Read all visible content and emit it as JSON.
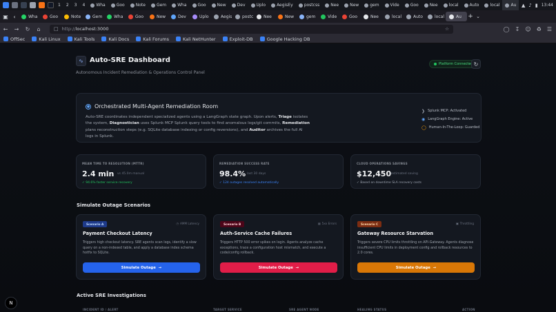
{
  "taskbar": {
    "workspaces": [
      "1",
      "2",
      "3",
      "4"
    ],
    "windows": [
      "Wha",
      "Goo",
      "Note",
      "Gem",
      "Wha",
      "Goo",
      "New",
      "Dev",
      "Uplo",
      "AegisEy",
      "postcss",
      "Nee",
      "New",
      "gem",
      "Vide",
      "Goo",
      "Nee",
      "local",
      "Auto",
      "local",
      "Au"
    ],
    "clock": "13:44"
  },
  "browser": {
    "tabs": [
      "Auto",
      "Auto",
      "Auto",
      "Auto",
      "Auto",
      "Auto",
      "Auto",
      "Auto",
      "Auto",
      "Auto",
      "Auto",
      "Auto",
      "Auto",
      "Auto",
      "Auto",
      "Auto",
      "Auto",
      "Auto",
      "Auto",
      "Auto",
      "Au"
    ],
    "url_prefix": "http://",
    "url_host": "localhost:3000",
    "bookmarks": [
      "OffSec",
      "Kali Linux",
      "Kali Tools",
      "Kali Docs",
      "Kali Forums",
      "Kali NetHunter",
      "Exploit-DB",
      "Google Hacking DB"
    ]
  },
  "header": {
    "title": "Auto-SRE Dashboard",
    "subtitle": "Autonomous Incident Remediation & Operations Control Panel",
    "status": "Platform Connected"
  },
  "orchestration": {
    "title": "Orchestrated Multi-Agent Remediation Room",
    "desc_1": "Auto-SRE coordinates independent specialized agents using a LangGraph state graph. Upon alerts, ",
    "triage": "Triage",
    "desc_2": " isolates the system, ",
    "diagnostician": "Diagnostician",
    "desc_3": " uses Splunk MCP Splunk query tools to find anomalous logs/git commits, ",
    "remediation": "Remediation",
    "desc_4": " plans reconstruction steps (e.g. SQLite database indexing or config reversions), and ",
    "auditor": "Auditor",
    "desc_5": " archives the full AI logs in Splunk.",
    "items": [
      "Splunk MCP: Activated",
      "LangGraph Engine: Active",
      "Human-In-The-Loop: Guarded"
    ]
  },
  "metrics": [
    {
      "label": "MEAN TIME TO RESOLUTION (MTTR)",
      "value": "2.4 min",
      "sub": "vs 45.0m manual",
      "foot": "✓ 94.6% faster service recovery",
      "foot_color": "#22c55e"
    },
    {
      "label": "REMEDIATION SUCCESS RATE",
      "value": "98.4%",
      "sub": "last 30 days",
      "foot": "✓ 124 outages resolved automatically",
      "foot_color": "#3b82f6"
    },
    {
      "label": "CLOUD OPERATIONS SAVINGS",
      "value": "$12,450",
      "sub": "estimated saving",
      "foot": "✓ Based on downtime SLA recovery costs",
      "foot_color": "#9ca3af"
    }
  ],
  "scenarios_title": "Simulate Outage Scenarios",
  "scenarios": [
    {
      "badge": "Scenario A",
      "tag": "AMM Latency",
      "title": "Payment Checkout Latency",
      "desc": "Triggers high checkout latency. SRE agents scan logs, identify a slow query on a non-indexed table, and apply a database index schema hotfix to SQLite.",
      "button": "Simulate Outage",
      "color": "#2563eb",
      "badge_bg": "#1e3a8a",
      "badge_fg": "#bfdbfe"
    },
    {
      "badge": "Scenario B",
      "tag": "5xx Errors",
      "title": "Auth-Service Cache Failures",
      "desc": "Triggers HTTP 500 error spikes on login. Agents analyze cache exceptions, trace a configuration host mismatch, and execute a code/config rollback.",
      "button": "Simulate Outage",
      "color": "#e11d48",
      "badge_bg": "#4c0519",
      "badge_fg": "#fecdd3"
    },
    {
      "badge": "Scenario C",
      "tag": "Throttling",
      "title": "Gateway Resource Starvation",
      "desc": "Triggers severe CPU limits throttling on API-Gateway. Agents diagnose insufficient CPU limits in deployment config and rollback resources to 2.0 cores.",
      "button": "Simulate Outage",
      "color": "#d97706",
      "badge_bg": "#7c2d12",
      "badge_fg": "#fed7aa"
    }
  ],
  "investigations": {
    "title": "Active SRE Investigations",
    "columns": [
      "INCIDENT ID / ALERT",
      "TARGET SERVICE",
      "SRE AGENT NODE",
      "HEALING STATUS",
      "ACTION"
    ]
  },
  "next_badge": "N"
}
